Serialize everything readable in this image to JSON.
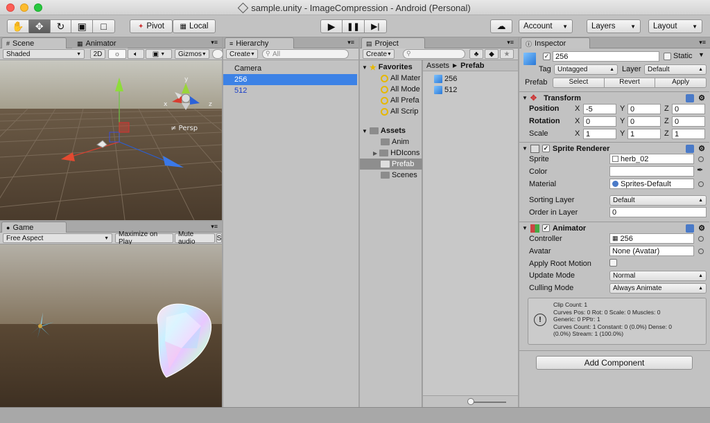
{
  "window": {
    "title": "sample.unity - ImageCompression - Android (Personal)"
  },
  "toolbar": {
    "tools": [
      "hand-tool",
      "move-tool",
      "rotate-tool",
      "scale-tool",
      "rect-tool"
    ],
    "pivot": "Pivot",
    "local": "Local",
    "account": "Account",
    "layers": "Layers",
    "layout": "Layout"
  },
  "scene": {
    "tab_label": "Scene",
    "tab2_label": "Animator",
    "shading": "Shaded",
    "mode_2d": "2D",
    "gizmos": "Gizmos",
    "persp": "≠ Persp",
    "axes": {
      "x": "x",
      "y": "y",
      "z": "z"
    }
  },
  "game": {
    "tab_label": "Game",
    "aspect": "Free Aspect",
    "maximize": "Maximize on Play",
    "mute": "Mute audio",
    "stats_stub": "S"
  },
  "hierarchy": {
    "tab_label": "Hierarchy",
    "create": "Create",
    "search_placeholder": "All",
    "items": [
      {
        "label": "Camera"
      },
      {
        "label": "256"
      },
      {
        "label": "512"
      }
    ]
  },
  "project": {
    "tab_label": "Project",
    "create": "Create",
    "favorites": "Favorites",
    "favorite_items": [
      "All Mater",
      "All Mode",
      "All Prefa",
      "All Scrip"
    ],
    "assets": "Assets",
    "folders": [
      "Anim",
      "HDIcons",
      "Prefab",
      "Scenes"
    ],
    "breadcrumb_root": "Assets",
    "breadcrumb_current": "Prefab",
    "files": [
      "256",
      "512"
    ]
  },
  "inspector": {
    "tab_label": "Inspector",
    "object_name": "256",
    "static_label": "Static",
    "tag_label": "Tag",
    "tag_value": "Untagged",
    "layer_label": "Layer",
    "layer_value": "Default",
    "prefab_label": "Prefab",
    "prefab_select": "Select",
    "prefab_revert": "Revert",
    "prefab_apply": "Apply",
    "transform": {
      "title": "Transform",
      "position_label": "Position",
      "rotation_label": "Rotation",
      "scale_label": "Scale",
      "position": {
        "x": "-5",
        "y": "0",
        "z": "0"
      },
      "rotation": {
        "x": "0",
        "y": "0",
        "z": "0"
      },
      "scale": {
        "x": "1",
        "y": "1",
        "z": "1"
      }
    },
    "sprite_renderer": {
      "title": "Sprite Renderer",
      "sprite_label": "Sprite",
      "sprite_value": "herb_02",
      "color_label": "Color",
      "material_label": "Material",
      "material_value": "Sprites-Default",
      "sorting_layer_label": "Sorting Layer",
      "sorting_layer_value": "Default",
      "order_label": "Order in Layer",
      "order_value": "0"
    },
    "animator": {
      "title": "Animator",
      "controller_label": "Controller",
      "controller_value": "256",
      "avatar_label": "Avatar",
      "avatar_value": "None (Avatar)",
      "root_motion_label": "Apply Root Motion",
      "update_mode_label": "Update Mode",
      "update_mode_value": "Normal",
      "culling_mode_label": "Culling Mode",
      "culling_mode_value": "Always Animate",
      "info_lines": [
        "Clip Count: 1",
        "Curves Pos: 0 Rot: 0 Scale: 0 Muscles: 0",
        "Generic: 0 PPtr: 1",
        "Curves Count: 1 Constant: 0 (0.0%) Dense: 0",
        "(0.0%) Stream: 1 (100.0%)"
      ]
    },
    "add_component": "Add Component"
  },
  "colors": {
    "selection": "#3c82e6",
    "scene_sky": "#b8b8b0",
    "scene_ground": "#5a4a3a",
    "game_sky": "#8a8070",
    "game_ground": "#4e3c2a"
  }
}
